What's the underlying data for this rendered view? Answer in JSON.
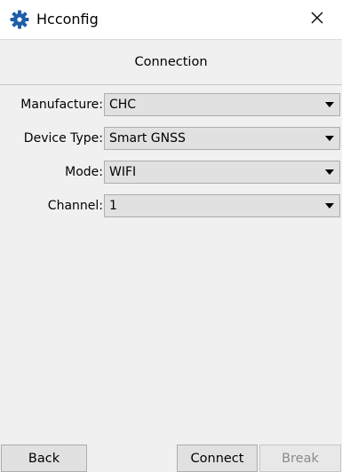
{
  "window": {
    "title": "Hcconfig",
    "icon": "gear-icon",
    "close_icon": "close-icon"
  },
  "header": {
    "title": "Connection"
  },
  "form": {
    "rows": [
      {
        "label": "Manufacture:",
        "value": "CHC"
      },
      {
        "label": "Device Type:",
        "value": "Smart GNSS"
      },
      {
        "label": "Mode:",
        "value": "WIFI"
      },
      {
        "label": "Channel:",
        "value": "1"
      }
    ]
  },
  "footer": {
    "back_label": "Back",
    "connect_label": "Connect",
    "break_label": "Break",
    "break_enabled": false
  },
  "colors": {
    "icon_blue": "#1f5fa8",
    "button_bg": "#e1e1e1",
    "disabled_text": "#8a8a8a"
  }
}
